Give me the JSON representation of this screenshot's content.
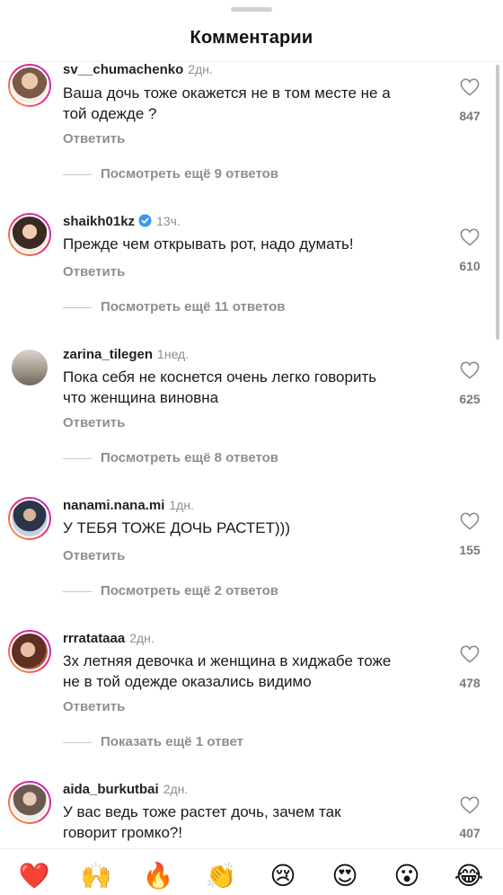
{
  "header": {
    "title": "Комментарии"
  },
  "comments": [
    {
      "username": "sv__chumachenko",
      "time": "2дн.",
      "verified": false,
      "text_lines": [
        "Ваша дочь  тоже окажется не в том месте не а",
        "той одежде ?"
      ],
      "reply": "Ответить",
      "likes": "847",
      "more": "Посмотреть ещё 9 ответов",
      "avatar_colors": [
        "#c9a98a",
        "#7a5a44"
      ]
    },
    {
      "username": "shaikh01kz",
      "time": "13ч.",
      "verified": true,
      "text_lines": [
        "Прежде чем открывать рот, надо думать!"
      ],
      "reply": "Ответить",
      "likes": "610",
      "more": "Посмотреть ещё 11 ответов",
      "avatar_colors": [
        "#e7c2a4",
        "#3a2a24"
      ]
    },
    {
      "username": "zarina_tilegen",
      "time": "1нед.",
      "verified": false,
      "text_lines": [
        "Пока себя не коснется очень легко говорить",
        "что женщина виновна"
      ],
      "reply": "Ответить",
      "likes": "625",
      "more": "Посмотреть ещё 8 ответов",
      "avatar_colors": [
        "#c8c2b8",
        "#6f675c"
      ]
    },
    {
      "username": "nanami.nana.mi",
      "time": "1дн.",
      "verified": false,
      "text_lines": [
        "У ТЕБЯ ТОЖЕ ДОЧЬ РАСТЕТ)))"
      ],
      "reply": "Ответить",
      "likes": "155",
      "more": "Посмотреть ещё 2 ответов",
      "avatar_colors": [
        "#b9c4d8",
        "#2b3448"
      ]
    },
    {
      "username": "rrratataaa",
      "time": "2дн.",
      "verified": false,
      "text_lines": [
        "3х летняя девочка и женщина в хиджабе тоже",
        "не в той одежде оказались видимо"
      ],
      "reply": "Ответить",
      "likes": "478",
      "more": "Показать ещё 1 ответ",
      "avatar_colors": [
        "#e2b59a",
        "#5e2f22"
      ]
    },
    {
      "username": "aida_burkutbai",
      "time": "2дн.",
      "verified": false,
      "text_lines": [
        "У вас ведь тоже растет дочь, зачем так",
        "говорит громко?!"
      ],
      "reply": "",
      "likes": "407",
      "more": "",
      "avatar_colors": [
        "#efe7df",
        "#6c5a4e"
      ]
    }
  ],
  "reactions": [
    "❤️",
    "🙌",
    "🔥",
    "👏",
    "😢",
    "😍",
    "😮",
    "😂"
  ],
  "colors": {
    "heart_red": "#ed4956",
    "muted": "#8e8e8e",
    "verified_blue": "#3897f0"
  }
}
